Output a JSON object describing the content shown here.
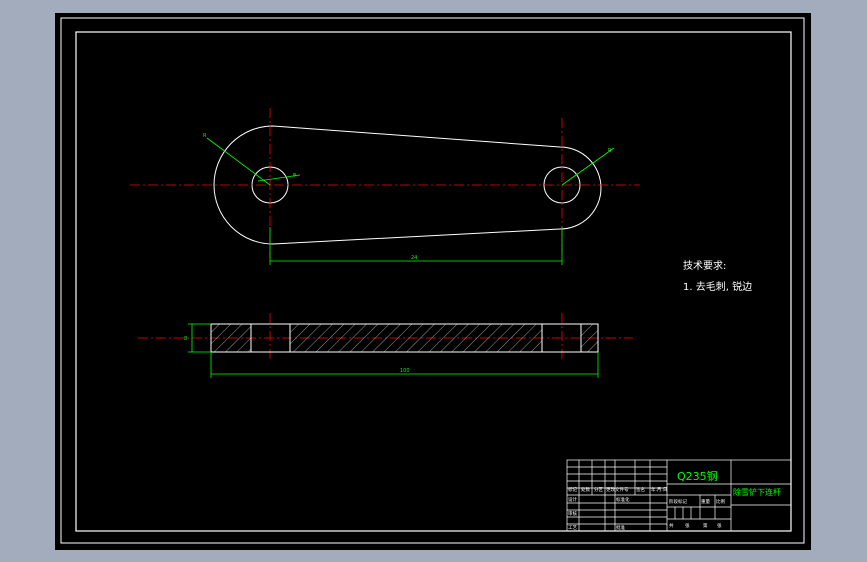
{
  "drawing": {
    "material": "Q235钢",
    "part_name": "除雪铲下连杆",
    "technical_requirements": {
      "title": "技术要求:",
      "items": [
        "1. 去毛刺, 锐边"
      ]
    },
    "dimensions": {
      "radius_left": "R",
      "hole_left": "φ",
      "radius_right": "R",
      "center_distance": "24",
      "length": "100",
      "thickness": "8"
    },
    "title_block": {
      "labels": [
        "标记",
        "处数",
        "分区",
        "更改文件号",
        "签名",
        "年.月.日",
        "设计",
        "标准化",
        "审核",
        "工艺",
        "批准",
        "阶段标记",
        "重量",
        "比例",
        "共",
        "张",
        "第",
        "张"
      ]
    },
    "colors": {
      "background": "#000000",
      "outline": "#ffffff",
      "centerline": "#ff0000",
      "dimension": "#00ff00",
      "hatch": "#ffffff",
      "frame": "#ffffff",
      "desktop": "#a2acbc"
    }
  }
}
